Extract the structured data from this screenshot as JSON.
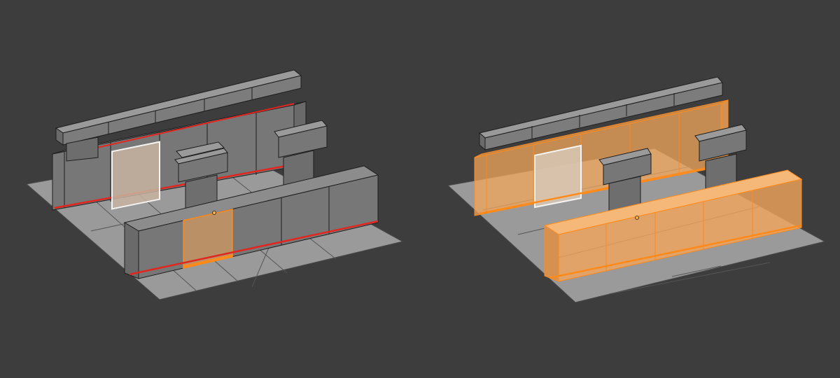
{
  "viewport": {
    "background_color": "#3d3d3d"
  },
  "colors": {
    "floor_fill": "#9a9a9a",
    "floor_line": "#4a4a4a",
    "block_front": "#777777",
    "block_side": "#6a6a6a",
    "block_top": "#8c8c8c",
    "edge": "#1e1e1e",
    "seam_red": "#e2261f",
    "selected_fill": "#f2a55a",
    "selected_edge": "#ff8a1a",
    "active_face_edge": "#f4f4f4",
    "origin_dot": "#ffb040"
  },
  "panels": [
    {
      "label": "",
      "state": "single-block-selected",
      "selected_face": "wall-front-tile",
      "selected_object": "front-wall-block-2"
    },
    {
      "label": "",
      "state": "whole-wall-selected",
      "selected_face": "back-wall-tile",
      "selected_object": "all-wall-blocks"
    }
  ]
}
